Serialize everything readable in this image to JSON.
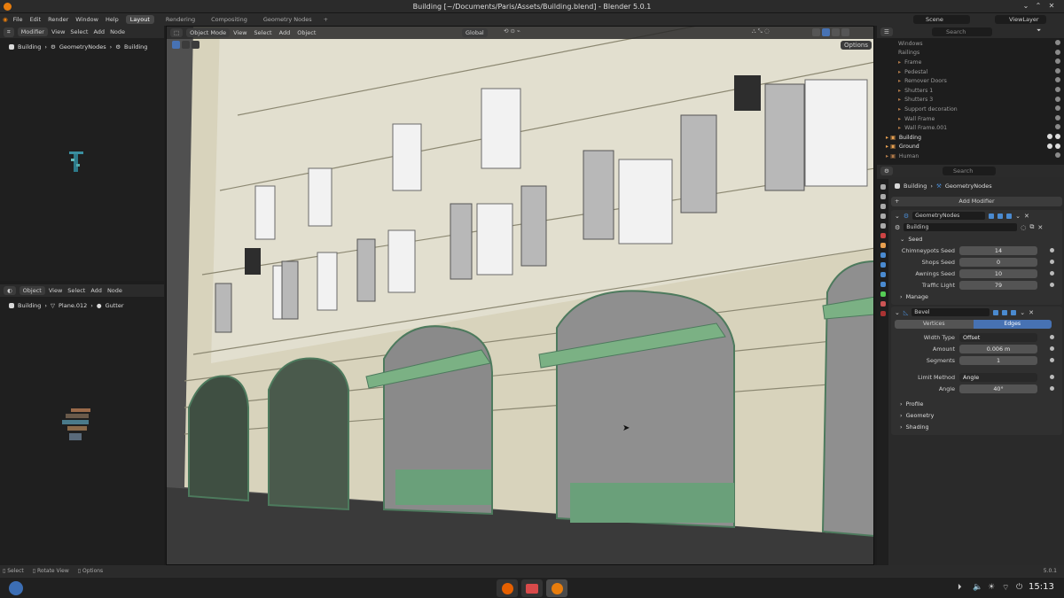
{
  "window": {
    "title": "Building [~/Documents/Paris/Assets/Building.blend] - Blender 5.0.1"
  },
  "menu": {
    "items": [
      "File",
      "Edit",
      "Render",
      "Window",
      "Help"
    ],
    "workspaces": [
      "Layout",
      "Rendering",
      "Compositing",
      "Geometry Nodes"
    ],
    "add_workspace": "+",
    "scene": "Scene",
    "view_layer": "ViewLayer"
  },
  "left_top": {
    "editor_mode": "Modifier",
    "menu": [
      "View",
      "Select",
      "Add",
      "Node"
    ],
    "breadcrumb": [
      "Building",
      "GeometryNodes",
      "Building"
    ]
  },
  "left_bottom": {
    "editor_mode": "Object",
    "menu": [
      "View",
      "Select",
      "Add",
      "Node"
    ],
    "breadcrumb": [
      "Building",
      "Plane.012",
      "Gutter"
    ]
  },
  "viewport": {
    "mode": "Object Mode",
    "menu": [
      "View",
      "Select",
      "Add",
      "Object"
    ],
    "orientation": "Global",
    "options": "Options"
  },
  "outliner": {
    "search_placeholder": "Search",
    "rows": [
      {
        "name": "Windows",
        "hi": false
      },
      {
        "name": "Railings",
        "hi": false
      },
      {
        "name": "Frame",
        "hi": false
      },
      {
        "name": "Pedestal",
        "hi": false
      },
      {
        "name": "Remover Doors",
        "hi": false
      },
      {
        "name": "Shutters 1",
        "hi": false
      },
      {
        "name": "Shutters 3",
        "hi": false
      },
      {
        "name": "Support decoration",
        "hi": false
      },
      {
        "name": "Wall Frame",
        "hi": false
      },
      {
        "name": "Wall Frame.001",
        "hi": false
      },
      {
        "name": "Building",
        "hi": true
      },
      {
        "name": "Ground",
        "hi": true
      },
      {
        "name": "Human",
        "hi": false
      }
    ]
  },
  "properties": {
    "search_placeholder": "Search",
    "breadcrumb": [
      "Building",
      "GeometryNodes"
    ],
    "add_modifier": "Add Modifier",
    "gn_modifier": {
      "name": "GeometryNodes",
      "node_group": "Building",
      "seed_panel": "Seed",
      "inputs": [
        {
          "label": "Chimneypots Seed",
          "value": "14"
        },
        {
          "label": "Shops Seed",
          "value": "0"
        },
        {
          "label": "Awnings Seed",
          "value": "10"
        },
        {
          "label": "Traffic Light",
          "value": "79"
        }
      ],
      "manage": "Manage"
    },
    "bevel_modifier": {
      "name": "Bevel",
      "tabs": [
        "Vertices",
        "Edges"
      ],
      "active_tab": "Edges",
      "width_type_label": "Width Type",
      "width_type": "Offset",
      "amount_label": "Amount",
      "amount": "0.006 m",
      "segments_label": "Segments",
      "segments": "1",
      "limit_method_label": "Limit Method",
      "limit_method": "Angle",
      "angle_label": "Angle",
      "angle": "40°",
      "subpanels": [
        "Profile",
        "Geometry",
        "Shading"
      ]
    }
  },
  "statusbar": {
    "items": [
      "Select",
      "Rotate View",
      "Options"
    ],
    "version": "5.0.1"
  },
  "taskbar": {
    "time": "15:13"
  }
}
